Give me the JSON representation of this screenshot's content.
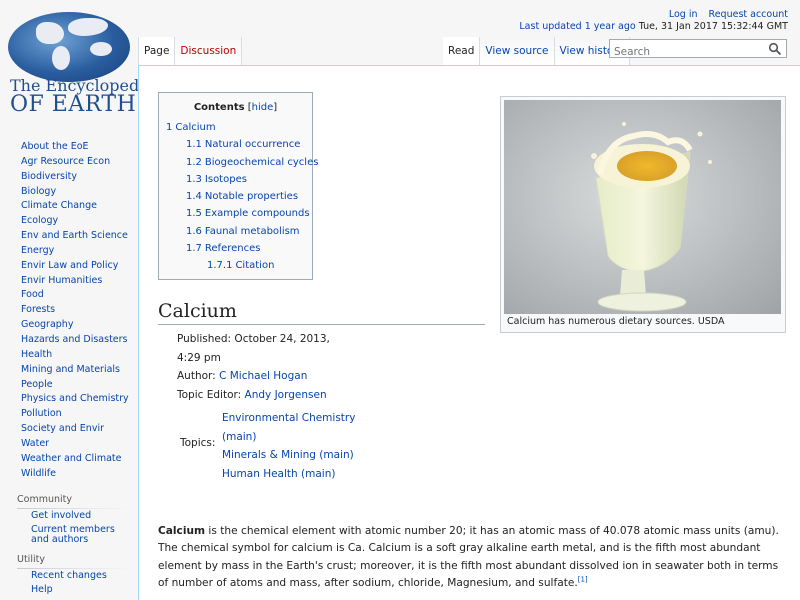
{
  "logo": {
    "line1": "The Encyclopedia",
    "line2": "OF EARTH"
  },
  "personal": {
    "login": "Log in",
    "request": "Request account"
  },
  "last_updated": {
    "link": "Last updated 1 year ago",
    "date": "Tue, 31 Jan 2017 15:32:44 GMT"
  },
  "tabs_left": [
    {
      "label": "Page",
      "selected": true
    },
    {
      "label": "Discussion",
      "new": true
    }
  ],
  "tabs_right": [
    {
      "label": "Read",
      "selected": true
    },
    {
      "label": "View source"
    },
    {
      "label": "View history"
    }
  ],
  "search": {
    "placeholder": "Search"
  },
  "sidebar": {
    "items": [
      "About the EoE",
      "Agr Resource Econ",
      "Biodiversity",
      "Biology",
      "Climate Change",
      "Ecology",
      "Env and Earth Science",
      "Energy",
      "Envir Law and Policy",
      "Envir Humanities",
      "Food",
      "Forests",
      "Geography",
      "Hazards and Disasters",
      "Health",
      "Mining and Materials",
      "People",
      "Physics and Chemistry",
      "Pollution",
      "Society and Envir",
      "Water",
      "Weather and Climate",
      "Wildlife"
    ],
    "community": {
      "title": "Community",
      "items": [
        "Get involved",
        "Current members and authors"
      ]
    },
    "utility": {
      "title": "Utility",
      "items": [
        "Recent changes",
        "Help"
      ]
    }
  },
  "toc": {
    "title": "Contents",
    "hide": "hide",
    "entries": [
      {
        "num": "1",
        "label": "Calcium",
        "level": 1
      },
      {
        "num": "1.1",
        "label": "Natural occurrence",
        "level": 2
      },
      {
        "num": "1.2",
        "label": "Biogeochemical cycles",
        "level": 2
      },
      {
        "num": "1.3",
        "label": "Isotopes",
        "level": 2
      },
      {
        "num": "1.4",
        "label": "Notable properties",
        "level": 2
      },
      {
        "num": "1.5",
        "label": "Example compounds",
        "level": 2
      },
      {
        "num": "1.6",
        "label": "Faunal metabolism",
        "level": 2
      },
      {
        "num": "1.7",
        "label": "References",
        "level": 2
      },
      {
        "num": "1.7.1",
        "label": "Citation",
        "level": 3
      }
    ]
  },
  "thumb": {
    "caption": "Calcium has numerous dietary sources. USDA"
  },
  "article": {
    "title": "Calcium",
    "published_label": "Published: October 24, 2013, 4:29 pm",
    "author_label": "Author:",
    "author": "C Michael Hogan",
    "editor_label": "Topic Editor:",
    "editor": "Andy Jorgensen",
    "topics_label": "Topics:",
    "topics": [
      "Environmental Chemistry (main)",
      "Minerals & Mining (main)",
      "Human Health (main)"
    ],
    "body_bold": "Calcium",
    "body_text": " is the chemical element with atomic number 20; it has an atomic mass of 40.078 atomic mass units (amu). The chemical symbol for calcium is Ca. Calcium is a soft gray alkaline earth metal, and is the fifth most abundant element by mass in the Earth's crust; moreover, it is the fifth most abundant dissolved ion in seawater both in terms of number of atoms and mass, after sodium, chloride, Magnesium, and sulfate.",
    "body_ref": "[1]"
  }
}
